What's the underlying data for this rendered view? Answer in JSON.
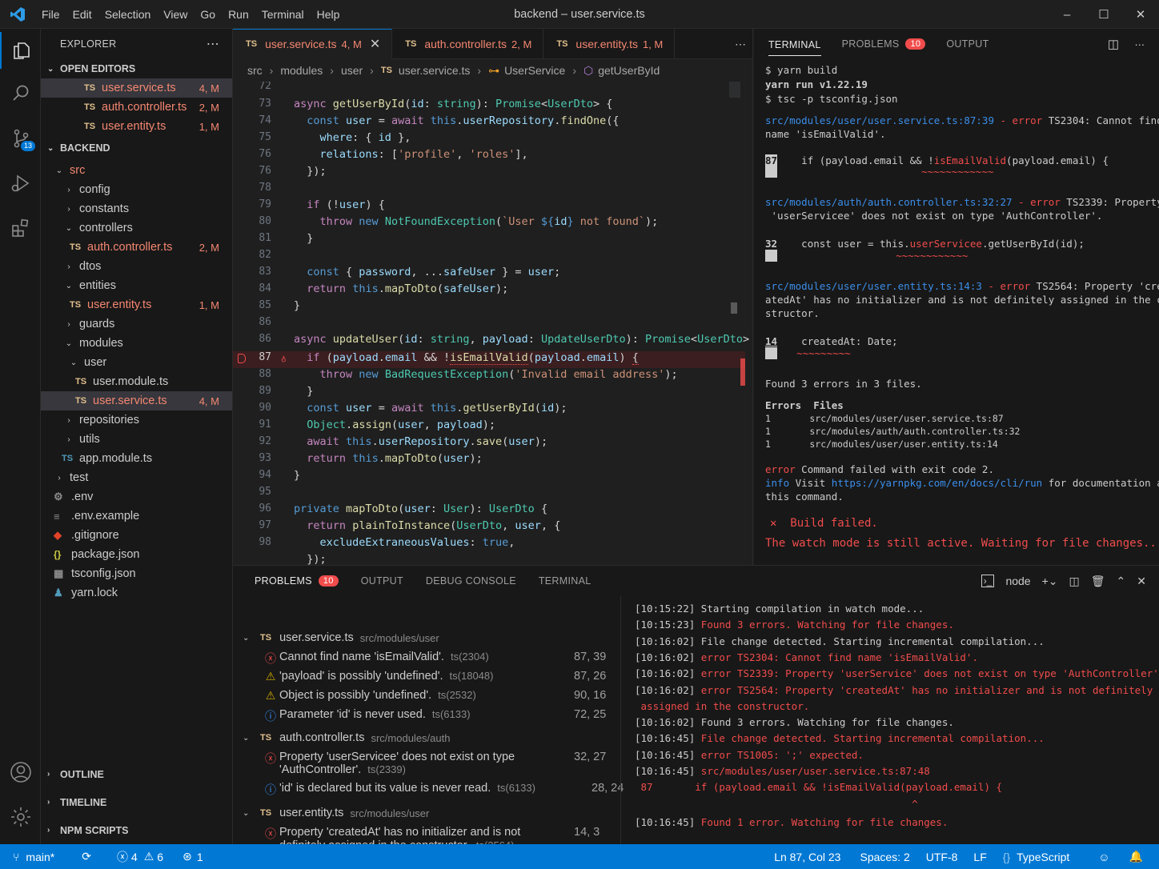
{
  "window": {
    "title": "backend – user.service.ts",
    "menu": [
      "File",
      "Edit",
      "Selection",
      "View",
      "Go",
      "Run",
      "Terminal",
      "Help"
    ],
    "controls": [
      "–",
      "☐",
      "✕"
    ]
  },
  "activity": {
    "source_control_badge": "13"
  },
  "explorer": {
    "header": "EXPLORER",
    "open_editors_label": "OPEN EDITORS",
    "open_editors": [
      {
        "name": "user.service.ts",
        "status": "4, M"
      },
      {
        "name": "auth.controller.ts",
        "status": "2, M"
      },
      {
        "name": "user.entity.ts",
        "status": "1, M"
      }
    ],
    "project_label": "BACKEND",
    "tree": {
      "src": "src",
      "config": "config",
      "constants": "constants",
      "controllers": "controllers",
      "auth_controller": "auth.controller.ts",
      "auth_controller_status": "2, M",
      "dtos": "dtos",
      "entities": "entities",
      "user_entity": "user.entity.ts",
      "user_entity_status": "1, M",
      "guards": "guards",
      "modules": "modules",
      "user": "user",
      "user_module": "user.module.ts",
      "user_service": "user.service.ts",
      "user_service_status": "4, M",
      "repositories": "repositories",
      "utils": "utils",
      "app_module": "app.module.ts",
      "test": "test",
      "env": ".env",
      "env_example": ".env.example",
      "gitignore": ".gitignore",
      "package_json": "package.json",
      "tsconfig": "tsconfig.json",
      "yarn_lock": "yarn.lock"
    },
    "outline": "OUTLINE",
    "timeline": "TIMELINE",
    "npm_scripts": "NPM SCRIPTS"
  },
  "editor": {
    "tabs": [
      {
        "name": "user.service.ts",
        "status": "4, M"
      },
      {
        "name": "auth.controller.ts",
        "status": "2, M"
      },
      {
        "name": "user.entity.ts",
        "status": "1, M"
      }
    ],
    "breadcrumb": [
      "src",
      "modules",
      "user",
      "user.service.ts",
      "UserService",
      "getUserById"
    ],
    "line_numbers": [
      "72",
      "73",
      "74",
      "75",
      "76",
      "76",
      "78",
      "79",
      "80",
      "81",
      "82",
      "83",
      "84",
      "85",
      "86",
      "86",
      "87",
      "88",
      "89",
      "90",
      "91",
      "92",
      "93",
      "94",
      "95",
      "96",
      "97",
      "98"
    ]
  },
  "right_terminal": {
    "tabs": {
      "terminal": "TERMINAL",
      "problems": "PROBLEMS",
      "problems_count": "10",
      "output": "OUTPUT"
    },
    "lines": {
      "l1": "$ yarn build",
      "l2": "yarn run v1.22.19",
      "l3": "$ tsc -p tsconfig.json",
      "e1_path": "src/modules/user/user.service.ts:87:39",
      "e1_err": " - error",
      "e1_msg": " TS2304: Cannot find",
      "e1_msg2": "name 'isEmailValid'.",
      "e1_lnum": "87",
      "e1_code": "    if (payload.email && !",
      "e1_code_hl": "isEmailValid",
      "e1_code_end": "(payload.email) {",
      "e1_squig": "~~~~~~~~~~~~",
      "e2_path": "src/modules/auth/auth.controller.ts:32:27",
      "e2_err": " - error",
      "e2_msg": " TS2339: Property",
      "e2_msg2": " 'userServicee' does not exist on type 'AuthController'.",
      "e2_lnum": "32",
      "e2_code": "    const user = this.",
      "e2_code_hl": "userServicee",
      "e2_code_end": ".getUserById(id);",
      "e2_squig": "~~~~~~~~~~~~",
      "e3_path": "src/modules/user/user.entity.ts:14:3",
      "e3_err": " - error",
      "e3_msg": " TS2564: Property 'cre.",
      "e3_msg2": "atedAt' has no initializer and is not definitely assigned in the co-",
      "e3_msg3": "structor.",
      "e3_lnum": "14",
      "e3_code": "    createdAt: Date;",
      "e3_squig": "~~~~~~~~~",
      "found": "Found 3 errors in 3 files.",
      "tbl_head": "Errors  Files",
      "tbl_r1": "1       src/modules/user/user.service.ts:87",
      "tbl_r2": "1       src/modules/auth/auth.controller.ts:32",
      "tbl_r3": "1       src/modules/user/user.entity.ts:14",
      "cmd_err": "error",
      "cmd_err_msg": " Command failed with exit code 2.",
      "info": "info",
      "info_msg": " Visit ",
      "info_url": "https://yarnpkg.com/en/docs/cli/run",
      "info_msg2": " for documentation about",
      "info_msg3": "this command.",
      "build_failed": "✕  Build failed.",
      "watch": "The watch mode is still active. Waiting for file changes..."
    }
  },
  "panel": {
    "tabs": {
      "problems": "PROBLEMS",
      "problems_count": "10",
      "output": "OUTPUT",
      "debug": "DEBUG CONSOLE",
      "terminal": "TERMINAL"
    },
    "node_label": "node",
    "groups": [
      {
        "file": "user.service.ts",
        "path": "src/modules/user"
      },
      {
        "file": "auth.controller.ts",
        "path": "src/modules/auth"
      },
      {
        "file": "user.entity.ts",
        "path": "src/modules/user"
      }
    ],
    "problems": [
      {
        "msg": "Cannot find name 'isEmailValid'.",
        "code": "ts(2304)",
        "pos": "87, 39"
      },
      {
        "msg": "'payload' is possibly 'undefined'.",
        "code": "ts(18048)",
        "pos": "87, 26"
      },
      {
        "msg": "Object is possibly 'undefined'.",
        "code": "ts(2532)",
        "pos": "90, 16"
      },
      {
        "msg": "Parameter 'id' is never used.",
        "code": "ts(6133)",
        "pos": "72, 25"
      },
      {
        "msg": "Property 'userServicee' does not exist on type",
        "msg2": "'AuthController'.",
        "code": "ts(2339)",
        "pos": "32, 27"
      },
      {
        "msg": "'id' is declared but its value is never read.",
        "code": "ts(6133)",
        "pos": "28, 24"
      },
      {
        "msg": "Property 'createdAt' has no initializer and is not",
        "msg2": "definitely assigned in the constructor.",
        "code": "ts(2564)",
        "pos": "14, 3"
      }
    ],
    "watch_lines": [
      {
        "ts": "[10:15:22]",
        "text": " Starting compilation in watch mode...",
        "red": false
      },
      {
        "ts": "[10:15:23]",
        "text": " Found 3 errors. Watching for file changes.",
        "red": true
      },
      {
        "ts": "[10:16:02]",
        "text": " File change detected. Starting incremental compilation...",
        "red": false
      },
      {
        "ts": "[10:16:02]",
        "text": " error TS2304: Cannot find name 'isEmailValid'.",
        "red": true
      },
      {
        "ts": "[10:16:02]",
        "text": " error TS2339: Property 'userService' does not exist on type 'AuthController'.",
        "red": true
      },
      {
        "ts": "[10:16:02]",
        "text": " error TS2564: Property 'createdAt' has no initializer and is not definitely",
        "red": true
      },
      {
        "ts": "",
        "text": " assigned in the constructor.",
        "red": true
      },
      {
        "ts": "[10:16:02]",
        "text": " Found 3 errors. Watching for file changes.",
        "red": false
      },
      {
        "ts": "[10:16:45]",
        "text": " File change detected. Starting incremental compilation...",
        "red": true
      },
      {
        "ts": "[10:16:45]",
        "text": " error TS1005: ';' expected.",
        "red": true
      },
      {
        "ts": "[10:16:45]",
        "text": " src/modules/user/user.service.ts:87:48",
        "red": true
      },
      {
        "ts": "",
        "text": " 87       if (payload.email && !isEmailValid(payload.email) {",
        "red": true
      },
      {
        "ts": "",
        "text": "                                              ^",
        "red": true
      },
      {
        "ts": "[10:16:45]",
        "text": " Found 1 error. Watching for file changes.",
        "red": true
      }
    ]
  },
  "status": {
    "branch": "main*",
    "errors": "4",
    "warnings": "6",
    "ports": "1",
    "position": "Ln 87, Col 23",
    "spaces": "Spaces: 2",
    "encoding": "UTF-8",
    "eol": "LF",
    "language": "TypeScript"
  },
  "colors": {
    "accent": "#0078d4",
    "error": "#f14c4c",
    "modified": "#e2c08d"
  }
}
